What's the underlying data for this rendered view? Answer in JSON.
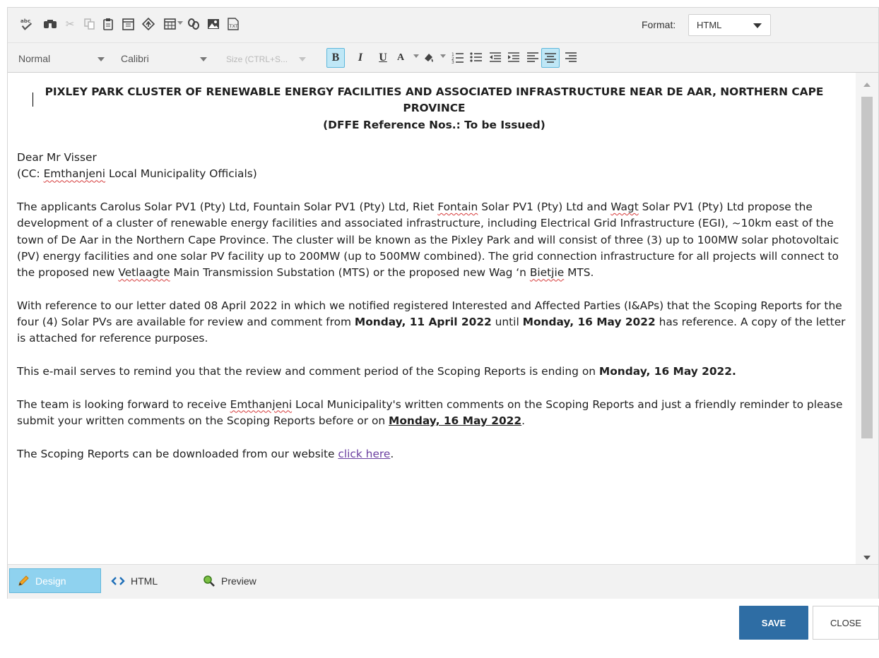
{
  "toolbar": {
    "icons": [
      "spellcheck-icon",
      "find-icon",
      "cut-icon",
      "copy-icon",
      "paste-icon",
      "template-icon",
      "paragraph-icon",
      "table-icon",
      "link-icon",
      "image-icon",
      "text-file-icon"
    ],
    "format_label": "Format:",
    "format_value": "HTML",
    "paragraph_style": "Normal",
    "font_name": "Calibri",
    "font_size_placeholder": "Size (CTRL+S..."
  },
  "format_buttons": {
    "bold": "B",
    "italic": "I",
    "underline": "U",
    "font_color": "A"
  },
  "document": {
    "heading_line1": "PIXLEY PARK CLUSTER OF RENEWABLE ENERGY FACILITIES AND ASSOCIATED INFRASTRUCTURE NEAR DE AAR, NORTHERN CAPE PROVINCE",
    "heading_line2": "(DFFE Reference Nos.: To be Issued)",
    "greeting": "Dear Mr Visser",
    "cc_prefix": "(CC: ",
    "cc_name": "Emthanjeni",
    "cc_suffix": " Local Municipality Officials)",
    "p1_a": "The applicants Carolus Solar PV1 (Pty) Ltd, Fountain Solar PV1 (Pty) Ltd, Riet ",
    "p1_fontain": "Fontain",
    "p1_b": " Solar PV1 (Pty) Ltd and ",
    "p1_wagt": "Wagt",
    "p1_c": " Solar PV1 (Pty) Ltd propose the development of a cluster of renewable energy facilities and associated infrastructure, including Electrical Grid Infrastructure (EGI), ~10km east of the town of De Aar in the Northern Cape Province.  The cluster will be known as the Pixley Park and will consist of three (3) up to 100MW solar photovoltaic (PV) energy facilities and one solar PV facility up to 200MW (up to 500MW combined).  The grid connection infrastructure for all projects will connect to the proposed new ",
    "p1_vetlaagte": "Vetlaagte",
    "p1_d": " Main Transmission Substation (MTS) or the proposed new Wag ‘n ",
    "p1_bietjie": "Bietjie",
    "p1_e": " MTS.",
    "p2_a": "With reference to our letter dated 08 April 2022 in which we notified registered Interested and Affected Parties (I&APs) that the Scoping Reports for the four (4) Solar PVs are available for review and comment from ",
    "p2_date1": "Monday, 11 April 2022",
    "p2_b": " until ",
    "p2_date2": "Monday, 16 May 2022",
    "p2_c": " has reference.  A copy of the letter is attached for reference purposes.",
    "p3_a": "This e-mail serves to remind you that the review and comment period of the Scoping Reports is ending on ",
    "p3_date": "Monday, 16 May 2022.",
    "p4_a": "The team is looking forward to receive ",
    "p4_name": "Emthanjeni",
    "p4_b": " Local Municipality's written comments on the Scoping Reports and just a friendly reminder to please submit your written comments on the Scoping Reports before or on ",
    "p4_date": "Monday, 16 May 2022",
    "p4_c": ".",
    "p5_a": "The Scoping Reports can be downloaded from our website ",
    "p5_link": "click here",
    "p5_b": "."
  },
  "modes": {
    "design": "Design",
    "html": "HTML",
    "preview": "Preview"
  },
  "actions": {
    "save": "SAVE",
    "close": "CLOSE"
  },
  "colors": {
    "save_button": "#2e6da4",
    "active_mode": "#8fd2ef",
    "link": "#6b3fa0"
  }
}
